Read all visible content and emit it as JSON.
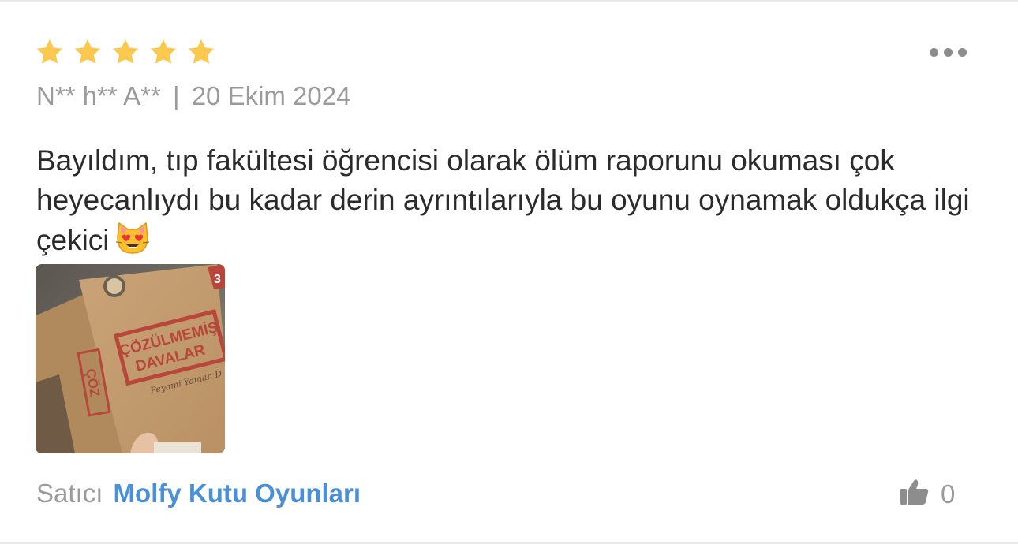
{
  "review": {
    "rating": 5,
    "rating_max": 5,
    "author": "N** h** A**",
    "separator": "|",
    "date": "20 Ekim 2024",
    "text": "Bayıldım, tıp fakültesi öğrencisi olarak ölüm raporunu okuması çok heyecanlıydı bu kadar derin ayrıntılarıyla bu oyunu oynamak oldukça ilgi çekici",
    "emoji_icon": "smiling-cat-heart-eyes-icon",
    "photo": {
      "title_line1": "ÇÖZÜLMEMİŞ",
      "title_line2": "DAVALAR",
      "signature": "Peyami Yaman D",
      "side_text": "ÇÖZ",
      "badge": "3"
    }
  },
  "seller": {
    "label": "Satıcı",
    "name": "Molfy Kutu Oyunları"
  },
  "likes": {
    "count": "0",
    "icon": "thumbs-up-icon"
  },
  "menu_icon": "more-dots-icon",
  "colors": {
    "star": "#fbc94e",
    "seller_link": "#4a90d9",
    "muted_text": "#9b9b9b",
    "body_text": "#2b2b2b"
  }
}
